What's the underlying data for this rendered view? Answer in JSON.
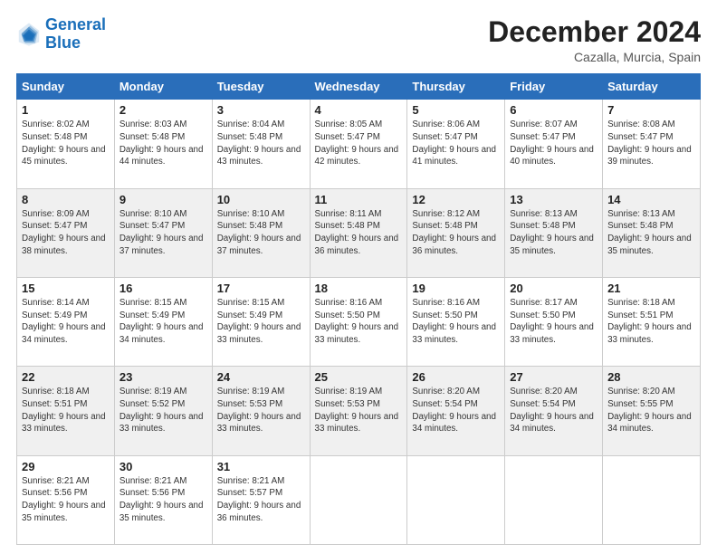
{
  "header": {
    "logo_line1": "General",
    "logo_line2": "Blue",
    "month": "December 2024",
    "location": "Cazalla, Murcia, Spain"
  },
  "weekdays": [
    "Sunday",
    "Monday",
    "Tuesday",
    "Wednesday",
    "Thursday",
    "Friday",
    "Saturday"
  ],
  "weeks": [
    [
      {
        "day": "1",
        "sunrise": "Sunrise: 8:02 AM",
        "sunset": "Sunset: 5:48 PM",
        "daylight": "Daylight: 9 hours and 45 minutes."
      },
      {
        "day": "2",
        "sunrise": "Sunrise: 8:03 AM",
        "sunset": "Sunset: 5:48 PM",
        "daylight": "Daylight: 9 hours and 44 minutes."
      },
      {
        "day": "3",
        "sunrise": "Sunrise: 8:04 AM",
        "sunset": "Sunset: 5:48 PM",
        "daylight": "Daylight: 9 hours and 43 minutes."
      },
      {
        "day": "4",
        "sunrise": "Sunrise: 8:05 AM",
        "sunset": "Sunset: 5:47 PM",
        "daylight": "Daylight: 9 hours and 42 minutes."
      },
      {
        "day": "5",
        "sunrise": "Sunrise: 8:06 AM",
        "sunset": "Sunset: 5:47 PM",
        "daylight": "Daylight: 9 hours and 41 minutes."
      },
      {
        "day": "6",
        "sunrise": "Sunrise: 8:07 AM",
        "sunset": "Sunset: 5:47 PM",
        "daylight": "Daylight: 9 hours and 40 minutes."
      },
      {
        "day": "7",
        "sunrise": "Sunrise: 8:08 AM",
        "sunset": "Sunset: 5:47 PM",
        "daylight": "Daylight: 9 hours and 39 minutes."
      }
    ],
    [
      {
        "day": "8",
        "sunrise": "Sunrise: 8:09 AM",
        "sunset": "Sunset: 5:47 PM",
        "daylight": "Daylight: 9 hours and 38 minutes."
      },
      {
        "day": "9",
        "sunrise": "Sunrise: 8:10 AM",
        "sunset": "Sunset: 5:47 PM",
        "daylight": "Daylight: 9 hours and 37 minutes."
      },
      {
        "day": "10",
        "sunrise": "Sunrise: 8:10 AM",
        "sunset": "Sunset: 5:48 PM",
        "daylight": "Daylight: 9 hours and 37 minutes."
      },
      {
        "day": "11",
        "sunrise": "Sunrise: 8:11 AM",
        "sunset": "Sunset: 5:48 PM",
        "daylight": "Daylight: 9 hours and 36 minutes."
      },
      {
        "day": "12",
        "sunrise": "Sunrise: 8:12 AM",
        "sunset": "Sunset: 5:48 PM",
        "daylight": "Daylight: 9 hours and 36 minutes."
      },
      {
        "day": "13",
        "sunrise": "Sunrise: 8:13 AM",
        "sunset": "Sunset: 5:48 PM",
        "daylight": "Daylight: 9 hours and 35 minutes."
      },
      {
        "day": "14",
        "sunrise": "Sunrise: 8:13 AM",
        "sunset": "Sunset: 5:48 PM",
        "daylight": "Daylight: 9 hours and 35 minutes."
      }
    ],
    [
      {
        "day": "15",
        "sunrise": "Sunrise: 8:14 AM",
        "sunset": "Sunset: 5:49 PM",
        "daylight": "Daylight: 9 hours and 34 minutes."
      },
      {
        "day": "16",
        "sunrise": "Sunrise: 8:15 AM",
        "sunset": "Sunset: 5:49 PM",
        "daylight": "Daylight: 9 hours and 34 minutes."
      },
      {
        "day": "17",
        "sunrise": "Sunrise: 8:15 AM",
        "sunset": "Sunset: 5:49 PM",
        "daylight": "Daylight: 9 hours and 33 minutes."
      },
      {
        "day": "18",
        "sunrise": "Sunrise: 8:16 AM",
        "sunset": "Sunset: 5:50 PM",
        "daylight": "Daylight: 9 hours and 33 minutes."
      },
      {
        "day": "19",
        "sunrise": "Sunrise: 8:16 AM",
        "sunset": "Sunset: 5:50 PM",
        "daylight": "Daylight: 9 hours and 33 minutes."
      },
      {
        "day": "20",
        "sunrise": "Sunrise: 8:17 AM",
        "sunset": "Sunset: 5:50 PM",
        "daylight": "Daylight: 9 hours and 33 minutes."
      },
      {
        "day": "21",
        "sunrise": "Sunrise: 8:18 AM",
        "sunset": "Sunset: 5:51 PM",
        "daylight": "Daylight: 9 hours and 33 minutes."
      }
    ],
    [
      {
        "day": "22",
        "sunrise": "Sunrise: 8:18 AM",
        "sunset": "Sunset: 5:51 PM",
        "daylight": "Daylight: 9 hours and 33 minutes."
      },
      {
        "day": "23",
        "sunrise": "Sunrise: 8:19 AM",
        "sunset": "Sunset: 5:52 PM",
        "daylight": "Daylight: 9 hours and 33 minutes."
      },
      {
        "day": "24",
        "sunrise": "Sunrise: 8:19 AM",
        "sunset": "Sunset: 5:53 PM",
        "daylight": "Daylight: 9 hours and 33 minutes."
      },
      {
        "day": "25",
        "sunrise": "Sunrise: 8:19 AM",
        "sunset": "Sunset: 5:53 PM",
        "daylight": "Daylight: 9 hours and 33 minutes."
      },
      {
        "day": "26",
        "sunrise": "Sunrise: 8:20 AM",
        "sunset": "Sunset: 5:54 PM",
        "daylight": "Daylight: 9 hours and 34 minutes."
      },
      {
        "day": "27",
        "sunrise": "Sunrise: 8:20 AM",
        "sunset": "Sunset: 5:54 PM",
        "daylight": "Daylight: 9 hours and 34 minutes."
      },
      {
        "day": "28",
        "sunrise": "Sunrise: 8:20 AM",
        "sunset": "Sunset: 5:55 PM",
        "daylight": "Daylight: 9 hours and 34 minutes."
      }
    ],
    [
      {
        "day": "29",
        "sunrise": "Sunrise: 8:21 AM",
        "sunset": "Sunset: 5:56 PM",
        "daylight": "Daylight: 9 hours and 35 minutes."
      },
      {
        "day": "30",
        "sunrise": "Sunrise: 8:21 AM",
        "sunset": "Sunset: 5:56 PM",
        "daylight": "Daylight: 9 hours and 35 minutes."
      },
      {
        "day": "31",
        "sunrise": "Sunrise: 8:21 AM",
        "sunset": "Sunset: 5:57 PM",
        "daylight": "Daylight: 9 hours and 36 minutes."
      },
      null,
      null,
      null,
      null
    ]
  ]
}
